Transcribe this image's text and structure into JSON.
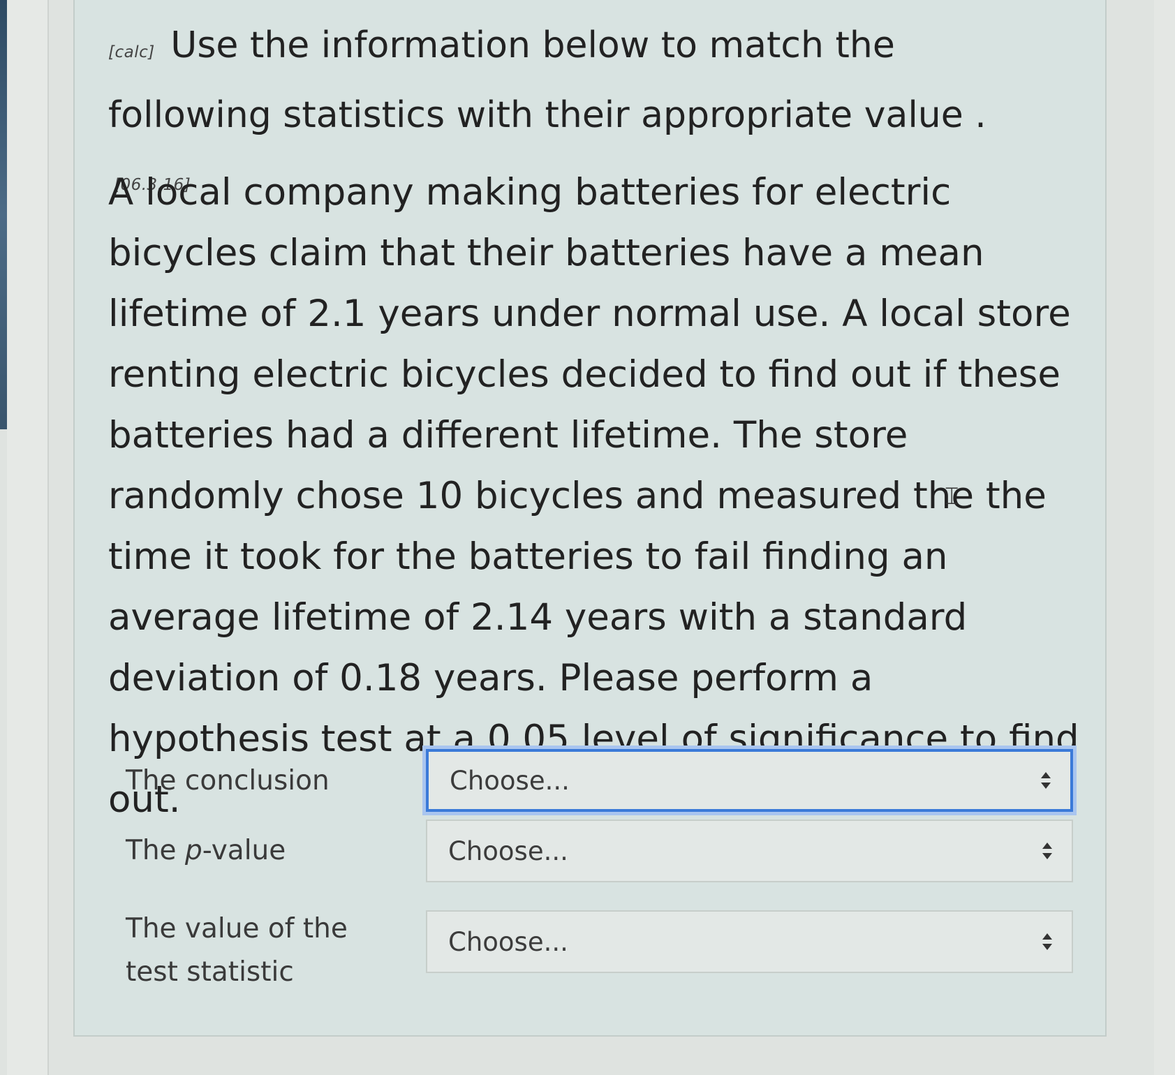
{
  "question": {
    "tag": "[calc]",
    "title": "Use the information below to match the following statistics with their appropriate value .",
    "reference": "[06.3.16]",
    "body": "A local company making batteries for electric bicycles claim that their batteries have a mean lifetime of 2.1 years under normal use. A local store renting electric bicycles decided to find out if these batteries had a different lifetime. The store randomly chose 10 bicycles and measured the the time it took for the batteries to fail finding an average lifetime of 2.14 years with a standard deviation of 0.18 years. Please perform a hypothesis test at a 0.05 level of significance to find out."
  },
  "matches": [
    {
      "label": "The conclusion",
      "selected": "Choose...",
      "focused": true
    },
    {
      "label_prefix": "The ",
      "label_italic": "p",
      "label_suffix": "-value",
      "selected": "Choose...",
      "focused": false
    },
    {
      "label": "The value of the test statistic",
      "selected": "Choose...",
      "focused": false
    }
  ],
  "icons": {
    "select_caret": "up-down-arrows-icon",
    "text_cursor": "i-beam-cursor-icon"
  },
  "colors": {
    "panel_background": "#d8e3e1",
    "focus_border": "#3b7ad8"
  }
}
